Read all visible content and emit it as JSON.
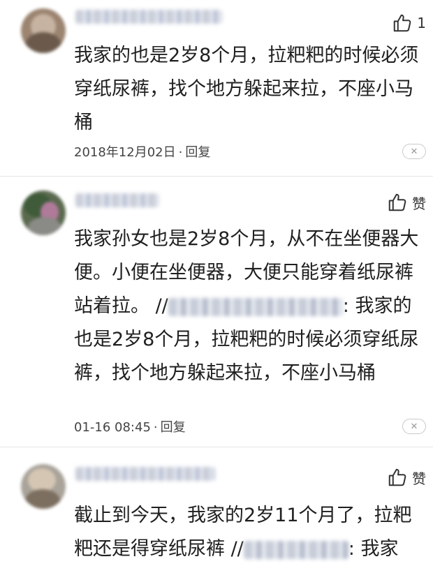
{
  "comments": [
    {
      "like_label": "1",
      "text": "我家的也是2岁8个月，拉粑粑的时候必须穿纸尿裤，找个地方躲起来拉，不座小马桶",
      "date": "2018年12月02日",
      "reply_label": "回复"
    },
    {
      "like_label": "赞",
      "text_before": "我家孙女也是2岁8个月，从不在坐便器大便。小便在坐便器，大便只能穿着纸尿裤站着拉。 //",
      "text_after": ": 我家的也是2岁8个月，拉粑粑的时候必须穿纸尿裤，找个地方躲起来拉，不座小马桶",
      "date": "01-16 08:45",
      "reply_label": "回复"
    },
    {
      "like_label": "赞",
      "text_before": "截止到今天，我家的2岁11个月了，拉粑粑还是得穿纸尿裤 //",
      "text_after": ": 我家"
    }
  ],
  "meta_separator": "·",
  "close_symbol": "✕",
  "icons": {
    "like": "thumbs-up-icon",
    "close": "close-icon"
  }
}
